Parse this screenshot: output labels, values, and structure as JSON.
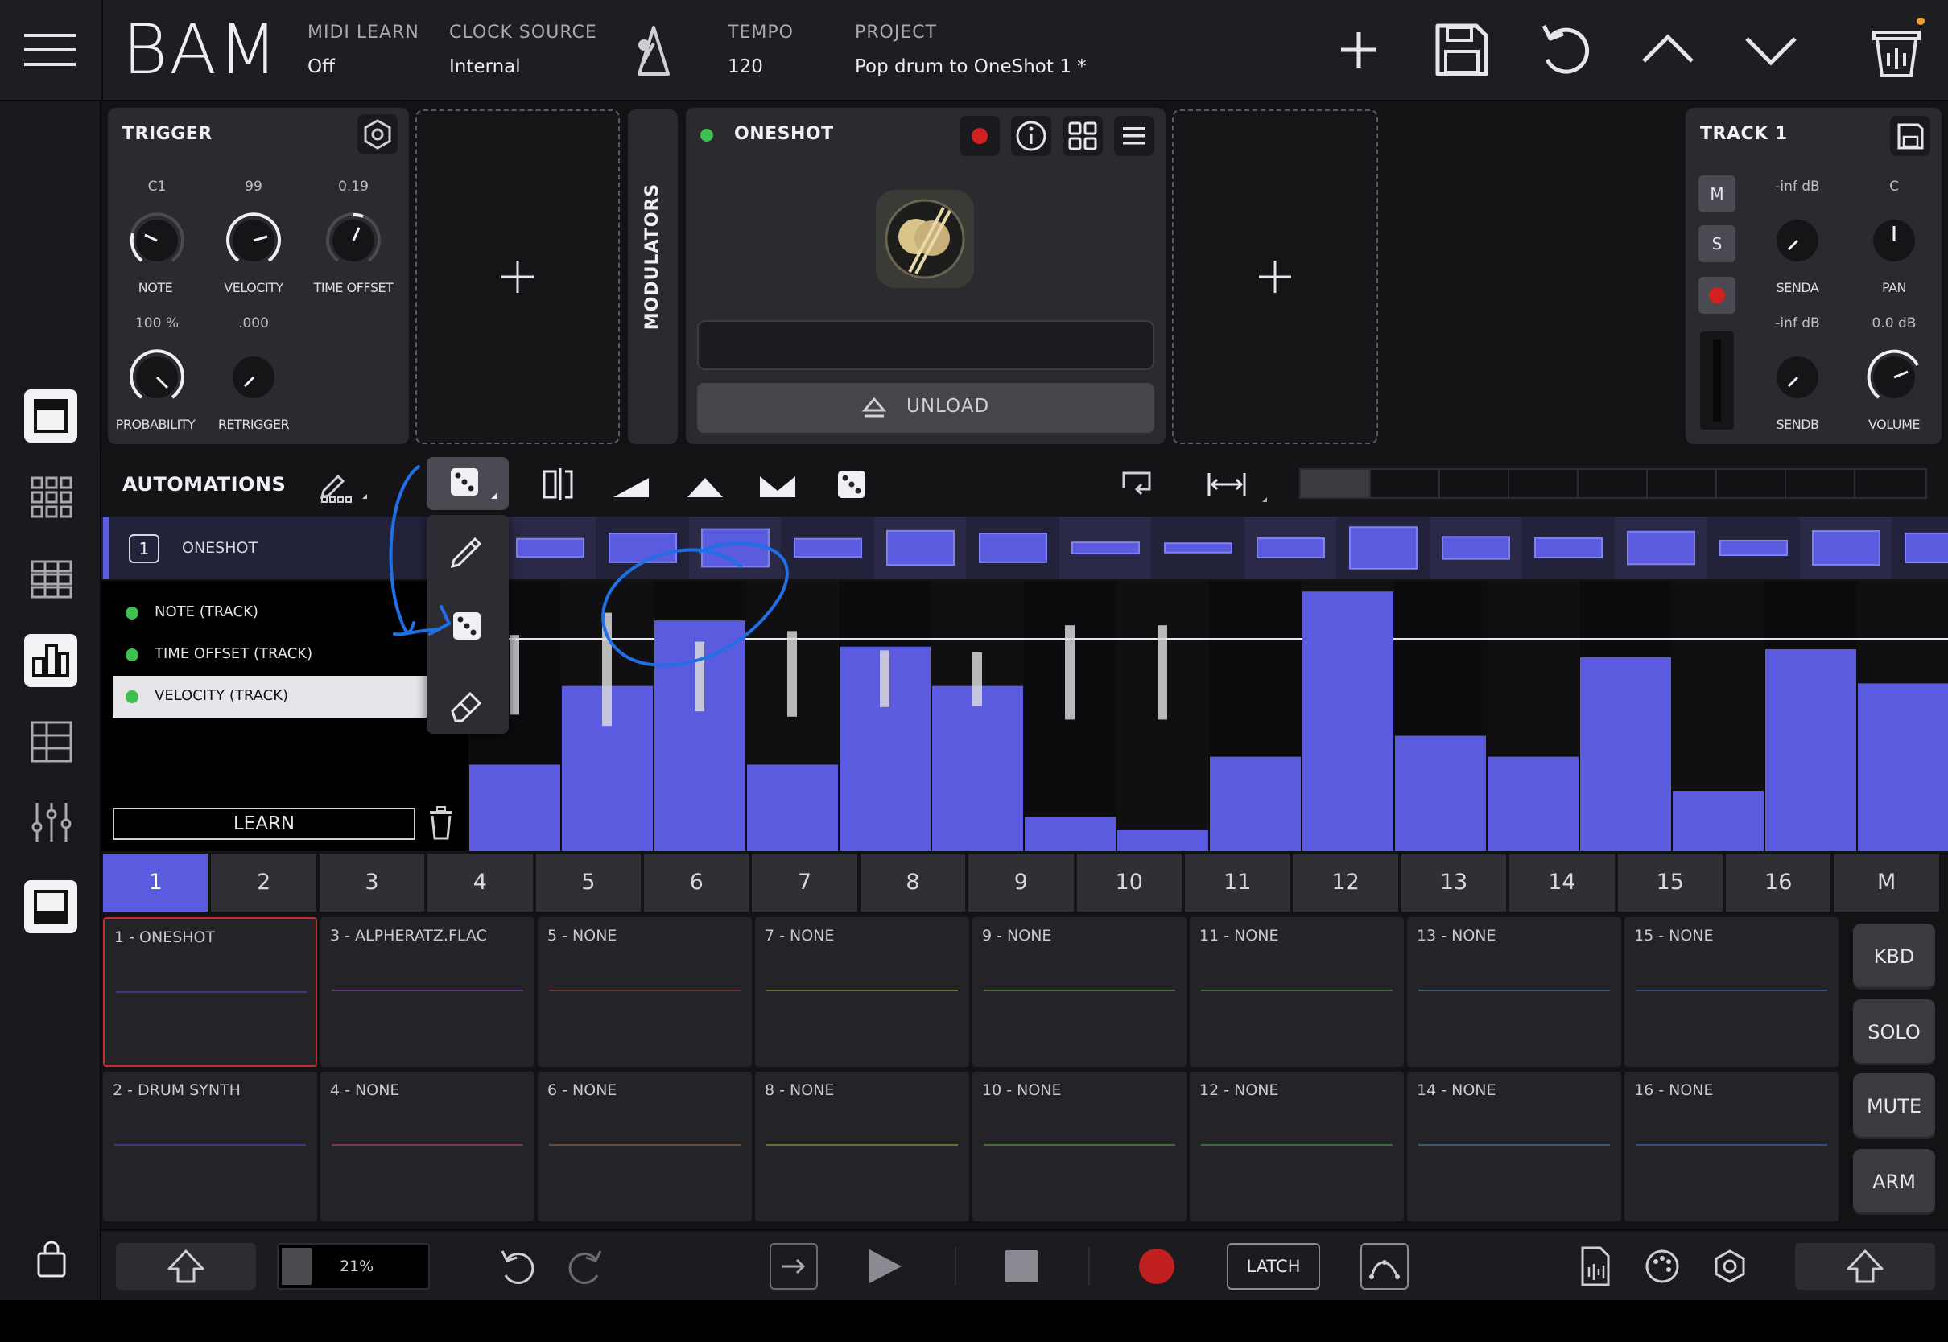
{
  "app": {
    "title": "BAM"
  },
  "header": {
    "midi_learn_label": "MIDI LEARN",
    "midi_learn_value": "Off",
    "clock_source_label": "CLOCK SOURCE",
    "clock_source_value": "Internal",
    "tempo_label": "TEMPO",
    "tempo_value": "120",
    "project_label": "PROJECT",
    "project_value": "Pop drum to OneShot 1 *",
    "icons": [
      "menu-icon",
      "metronome-icon",
      "add-icon",
      "save-icon",
      "undo-icon",
      "chevron-up-icon",
      "chevron-down-icon",
      "trash-icon"
    ]
  },
  "trigger": {
    "title": "TRIGGER",
    "knobs": [
      {
        "value": "C1",
        "label": "NOTE"
      },
      {
        "value": "99",
        "label": "VELOCITY"
      },
      {
        "value": "0.19",
        "label": "TIME OFFSET"
      },
      {
        "value": "100 %",
        "label": "PROBABILITY"
      },
      {
        "value": ".000",
        "label": "RETRIGGER"
      }
    ]
  },
  "modulators_label": "MODULATORS",
  "oneshot": {
    "title": "ONESHOT",
    "unload_label": "UNLOAD",
    "status_color": "#3fbf4f"
  },
  "track": {
    "title": "TRACK 1",
    "m_label": "M",
    "s_label": "S",
    "knobs": [
      {
        "value": "-inf dB",
        "label": "SENDA"
      },
      {
        "value": "C",
        "label": "PAN"
      },
      {
        "value": "-inf dB",
        "label": "SENDB"
      },
      {
        "value": "0.0 dB",
        "label": "VOLUME"
      }
    ]
  },
  "automations": {
    "title": "AUTOMATIONS",
    "lane_index": "1",
    "lane_name": "ONESHOT",
    "params": [
      "NOTE (TRACK)",
      "TIME OFFSET (TRACK)",
      "VELOCITY (TRACK)"
    ],
    "selected_param": 2,
    "learn_label": "LEARN",
    "accent_color": "#5b5be0",
    "step_values": [
      0.33,
      0.63,
      0.88,
      0.33,
      0.78,
      0.63,
      0.13,
      0.08,
      0.36,
      0.99,
      0.44,
      0.36,
      0.74,
      0.23,
      0.77,
      0.64
    ],
    "marker_values": [
      0.44,
      0.67,
      0.37,
      0.48,
      0.28,
      0.26,
      0.54,
      0.54,
      0.0,
      0.0,
      0.0,
      0.0,
      0.0,
      0.0,
      0.0,
      0.0
    ]
  },
  "steps": [
    "1",
    "2",
    "3",
    "4",
    "5",
    "6",
    "7",
    "8",
    "9",
    "10",
    "11",
    "12",
    "13",
    "14",
    "15",
    "16",
    "M"
  ],
  "active_step": 0,
  "tracks_top": [
    {
      "name": "1 - ONESHOT",
      "color": "#3a3a7a"
    },
    {
      "name": "3 - ALPHERATZ.FLAC",
      "color": "#5a3a7a"
    },
    {
      "name": "5 - NONE",
      "color": "#6a3a3a"
    },
    {
      "name": "7 - NONE",
      "color": "#6a6a3a"
    },
    {
      "name": "9 - NONE",
      "color": "#4a6a3a"
    },
    {
      "name": "11 - NONE",
      "color": "#3a6a3a"
    },
    {
      "name": "13 - NONE",
      "color": "#3a5a6a"
    },
    {
      "name": "15 - NONE",
      "color": "#3a4a7a"
    }
  ],
  "tracks_bottom": [
    {
      "name": "2 - DRUM SYNTH",
      "color": "#3a3a7a"
    },
    {
      "name": "4 - NONE",
      "color": "#7a3a4a"
    },
    {
      "name": "6 - NONE",
      "color": "#6a4a3a"
    },
    {
      "name": "8 - NONE",
      "color": "#6a6a3a"
    },
    {
      "name": "10 - NONE",
      "color": "#4a6a3a"
    },
    {
      "name": "12 - NONE",
      "color": "#3a6a4a"
    },
    {
      "name": "14 - NONE",
      "color": "#3a5a6a"
    },
    {
      "name": "16 - NONE",
      "color": "#3a4a7a"
    }
  ],
  "side_buttons": [
    "KBD",
    "SOLO",
    "MUTE",
    "ARM"
  ],
  "bottom": {
    "cpu_label": "21%",
    "cpu_value": 0.21,
    "latch_label": "LATCH"
  },
  "colors": {
    "accent": "#5b5be0",
    "record": "#d02020",
    "status_green": "#3fbf4f",
    "annotation": "#1f6fe6"
  }
}
